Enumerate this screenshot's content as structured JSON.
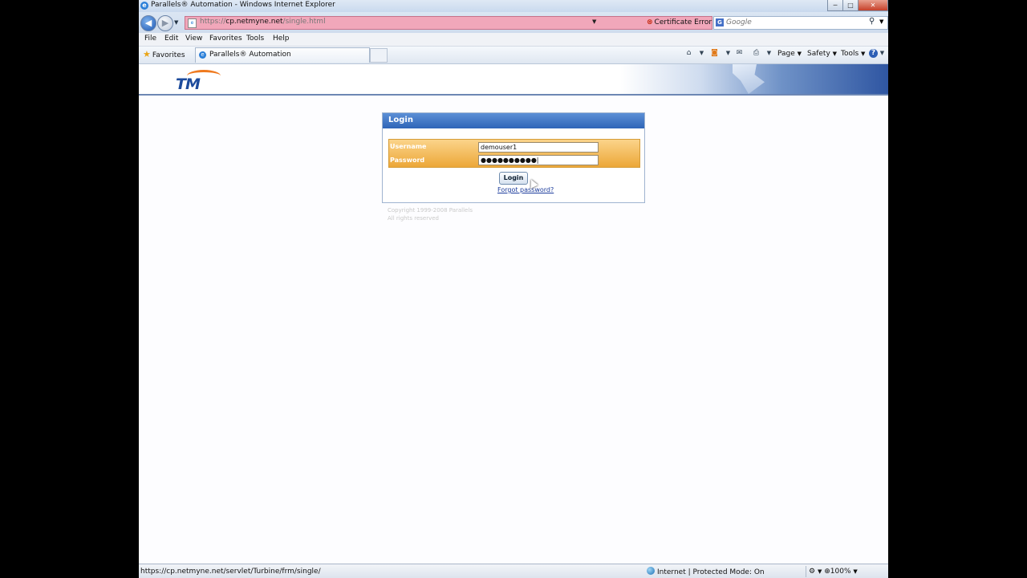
{
  "window": {
    "title": "Parallels® Automation - Windows Internet Explorer",
    "min_label": "─",
    "max_label": "□",
    "close_label": "✕"
  },
  "addressbar": {
    "url_host": "cp.netmyne.net",
    "url_prefix": "https://",
    "url_path": "/single.html",
    "certificate_error": "Certificate Error"
  },
  "search": {
    "placeholder": "Google"
  },
  "menu": [
    "File",
    "Edit",
    "View",
    "Favorites",
    "Tools",
    "Help"
  ],
  "favbar": {
    "favorites_label": "Favorites",
    "tab_title": "Parallels® Automation",
    "page_label": "Page",
    "safety_label": "Safety",
    "tools_label": "Tools"
  },
  "login": {
    "header": "Login",
    "username_label": "Username",
    "password_label": "Password",
    "username_value": "demouser1",
    "password_value": "●●●●●●●●●●|",
    "button_label": "Login",
    "forgot_label": "Forgot password?",
    "copyright_line1": "Copyright 1999-2008 Parallels",
    "copyright_line2": "All rights reserved"
  },
  "brand": {
    "logo_text": "TM",
    "logo_color": "#1d4b9c",
    "accent": "#ef7a1f"
  },
  "statusbar": {
    "status_url": "https://cp.netmyne.net/servlet/Turbine/frm/single/",
    "zone": "Internet | Protected Mode: On",
    "zoom": "100%"
  }
}
